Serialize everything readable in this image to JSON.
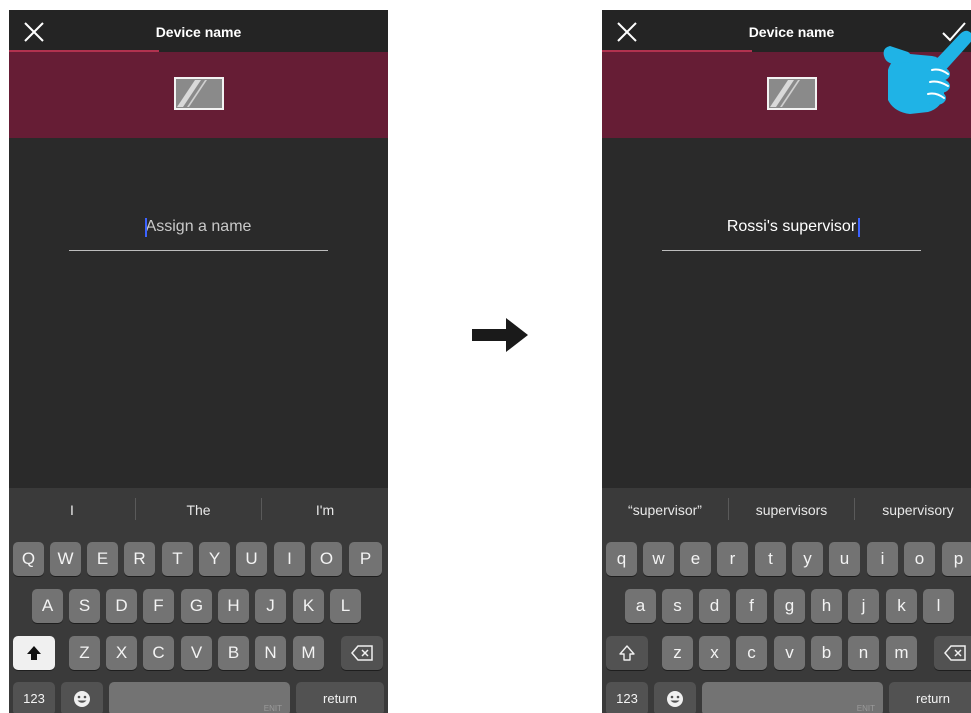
{
  "colors": {
    "accent": "#661d35",
    "title_underline": "#b1324f",
    "background_dark": "#2a2a2a",
    "caret": "#3c63ff",
    "hand": "#1fb3e6"
  },
  "icons": {
    "close": "close-icon",
    "confirm": "checkmark-icon",
    "device": "device-icon",
    "arrow": "right-arrow-icon",
    "hand": "pointing-hand-icon",
    "shift": "shift-icon",
    "backspace": "backspace-icon",
    "emoji": "emoji-icon"
  },
  "screen_before": {
    "header": {
      "title": "Device name"
    },
    "name_field": {
      "placeholder": "Assign a name",
      "value": ""
    },
    "keyboard": {
      "suggestions": [
        "I",
        "The",
        "I'm"
      ],
      "rows": [
        [
          "Q",
          "W",
          "E",
          "R",
          "T",
          "Y",
          "U",
          "I",
          "O",
          "P"
        ],
        [
          "A",
          "S",
          "D",
          "F",
          "G",
          "H",
          "J",
          "K",
          "L"
        ],
        [
          "Z",
          "X",
          "C",
          "V",
          "B",
          "N",
          "M"
        ]
      ],
      "numbers_key": "123",
      "return_key": "return",
      "space_mark": "ENIT"
    }
  },
  "screen_after": {
    "header": {
      "title": "Device name"
    },
    "name_field": {
      "placeholder": "",
      "value": "Rossi's supervisor"
    },
    "keyboard": {
      "suggestions": [
        "“supervisor”",
        "supervisors",
        "supervisory"
      ],
      "rows": [
        [
          "q",
          "w",
          "e",
          "r",
          "t",
          "y",
          "u",
          "i",
          "o",
          "p"
        ],
        [
          "a",
          "s",
          "d",
          "f",
          "g",
          "h",
          "j",
          "k",
          "l"
        ],
        [
          "z",
          "x",
          "c",
          "v",
          "b",
          "n",
          "m"
        ]
      ],
      "numbers_key": "123",
      "return_key": "return",
      "space_mark": "ENIT"
    }
  }
}
